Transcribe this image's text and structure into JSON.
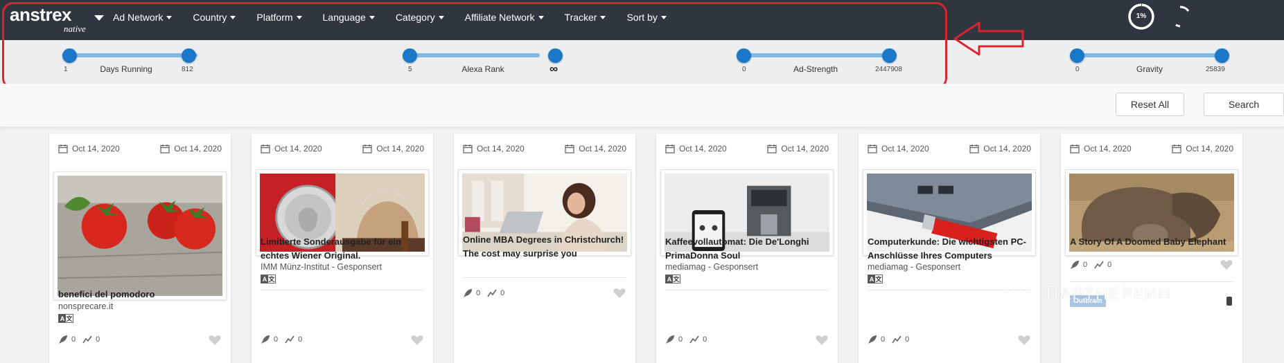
{
  "brand": {
    "name": "anstrex",
    "sub": "native"
  },
  "nav": [
    {
      "label": "Ad Network"
    },
    {
      "label": "Country"
    },
    {
      "label": "Platform"
    },
    {
      "label": "Language"
    },
    {
      "label": "Category"
    },
    {
      "label": "Affiliate Network"
    },
    {
      "label": "Tracker"
    },
    {
      "label": "Sort by"
    }
  ],
  "progress": {
    "text": "1%",
    "value": 0.01
  },
  "sliders": [
    {
      "name": "Days Running",
      "min": "1",
      "max": "812"
    },
    {
      "name": "Alexa Rank",
      "min": "5",
      "max": "∞"
    },
    {
      "name": "Ad-Strength",
      "min": "0",
      "max": "2447908"
    },
    {
      "name": "Gravity",
      "min": "0",
      "max": "25839"
    }
  ],
  "actions": {
    "reset": "Reset All",
    "search": "Search"
  },
  "cards": [
    {
      "date_first": "Oct 14, 2020",
      "date_last": "Oct 14, 2020",
      "title": "benefici del pomodoro",
      "source": "nonsprecare.it",
      "lang": {
        "a": "A",
        "b": "文"
      },
      "launches": "0",
      "trend": "0"
    },
    {
      "date_first": "Oct 14, 2020",
      "date_last": "Oct 14, 2020",
      "title": "Limitierte Sonderausgabe für ein echtes Wiener Original.",
      "source": "IMM Münz-Institut - Gesponsert",
      "lang": {
        "a": "A",
        "b": "文"
      },
      "launches": "0",
      "trend": "0"
    },
    {
      "date_first": "Oct 14, 2020",
      "date_last": "Oct 14, 2020",
      "title": "Online MBA Degrees in Christchurch! The cost may surprise you",
      "source": "",
      "launches": "0",
      "trend": "0"
    },
    {
      "date_first": "Oct 14, 2020",
      "date_last": "Oct 14, 2020",
      "title": "Kaffeevollautomat: Die De'Longhi PrimaDonna Soul",
      "source": "mediamag - Gesponsert",
      "lang": {
        "a": "A",
        "b": "文"
      },
      "launches": "0",
      "trend": "0"
    },
    {
      "date_first": "Oct 14, 2020",
      "date_last": "Oct 14, 2020",
      "title": "Computerkunde: Die wichtigsten PC-Anschlüsse Ihres Computers",
      "source": "mediamag - Gesponsert",
      "lang": {
        "a": "A",
        "b": "文"
      },
      "launches": "0",
      "trend": "0"
    },
    {
      "date_first": "Oct 14, 2020",
      "date_last": "Oct 14, 2020",
      "title": "A Story Of A Doomed Baby Elephant",
      "source": "",
      "launches": "0",
      "trend": "0",
      "network_badge": "Outbrain"
    }
  ],
  "watermark": "ПАРТНЕРКИН",
  "colors": {
    "topbar": "#2f3640",
    "slider_knob": "#1b78c8",
    "slider_track": "#7fb8e3",
    "annotation": "#d9262e",
    "badge": "#a9c5e3"
  },
  "icons": [
    "calendar-icon",
    "rocket-icon",
    "trend-icon",
    "heart-icon",
    "mobile-icon",
    "language-icon",
    "progress-ring-icon",
    "spinner-icon",
    "arrow-annotation-icon"
  ]
}
